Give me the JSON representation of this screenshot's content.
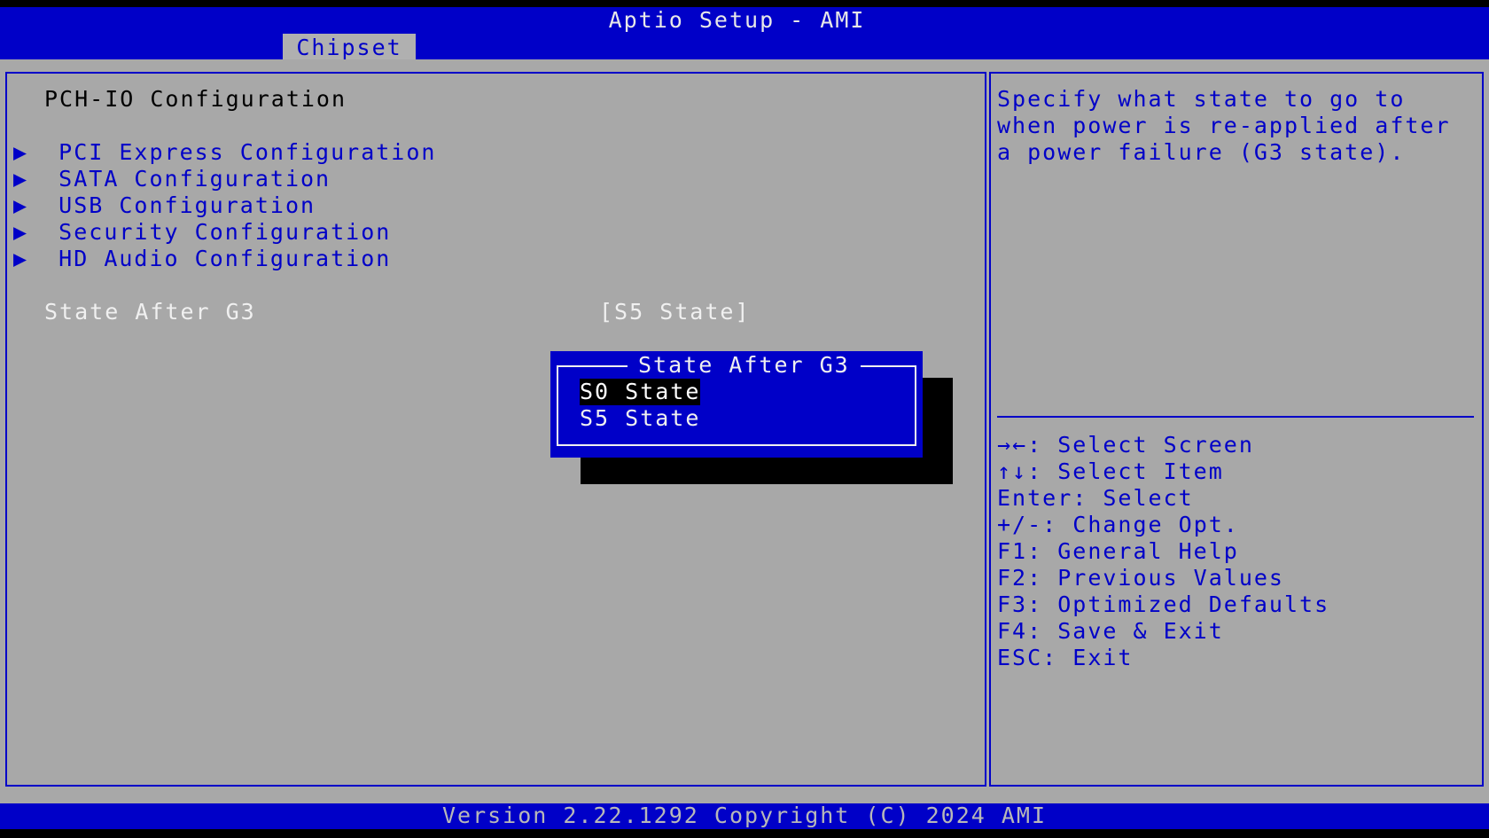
{
  "app": {
    "title": "Aptio Setup - AMI",
    "active_tab": "Chipset",
    "footer": "Version 2.22.1292 Copyright (C) 2024 AMI"
  },
  "page": {
    "heading": "PCH-IO Configuration",
    "submenus": [
      {
        "label": "PCI Express Configuration",
        "icon": "triangle-right-icon"
      },
      {
        "label": "SATA Configuration",
        "icon": "triangle-right-icon"
      },
      {
        "label": "USB Configuration",
        "icon": "triangle-right-icon"
      },
      {
        "label": "Security Configuration",
        "icon": "triangle-right-icon"
      },
      {
        "label": "HD Audio Configuration",
        "icon": "triangle-right-icon"
      }
    ],
    "submenu_marker": "▶",
    "setting": {
      "label": "State After G3",
      "value": "[S5 State]"
    }
  },
  "help": {
    "lines": [
      "Specify what state to go to",
      "when power is re-applied after",
      "a power failure (G3 state)."
    ]
  },
  "keys": [
    {
      "key": "→←:",
      "action": "Select Screen"
    },
    {
      "key": "↑↓:",
      "action": "Select Item"
    },
    {
      "key": "Enter:",
      "action": "Select"
    },
    {
      "key": "+/-:",
      "action": "Change Opt."
    },
    {
      "key": "F1:",
      "action": "General Help"
    },
    {
      "key": "F2:",
      "action": "Previous Values"
    },
    {
      "key": "F3:",
      "action": "Optimized Defaults"
    },
    {
      "key": "F4:",
      "action": "Save & Exit"
    },
    {
      "key": "ESC:",
      "action": "Exit"
    }
  ],
  "popup": {
    "title": "State After G3",
    "options": [
      "S0 State",
      "S5 State"
    ],
    "selected": "S0 State"
  },
  "colors": {
    "blue": "#0000c8",
    "panel_gray": "#a8a8a8",
    "text_white": "#f0f0f0"
  }
}
